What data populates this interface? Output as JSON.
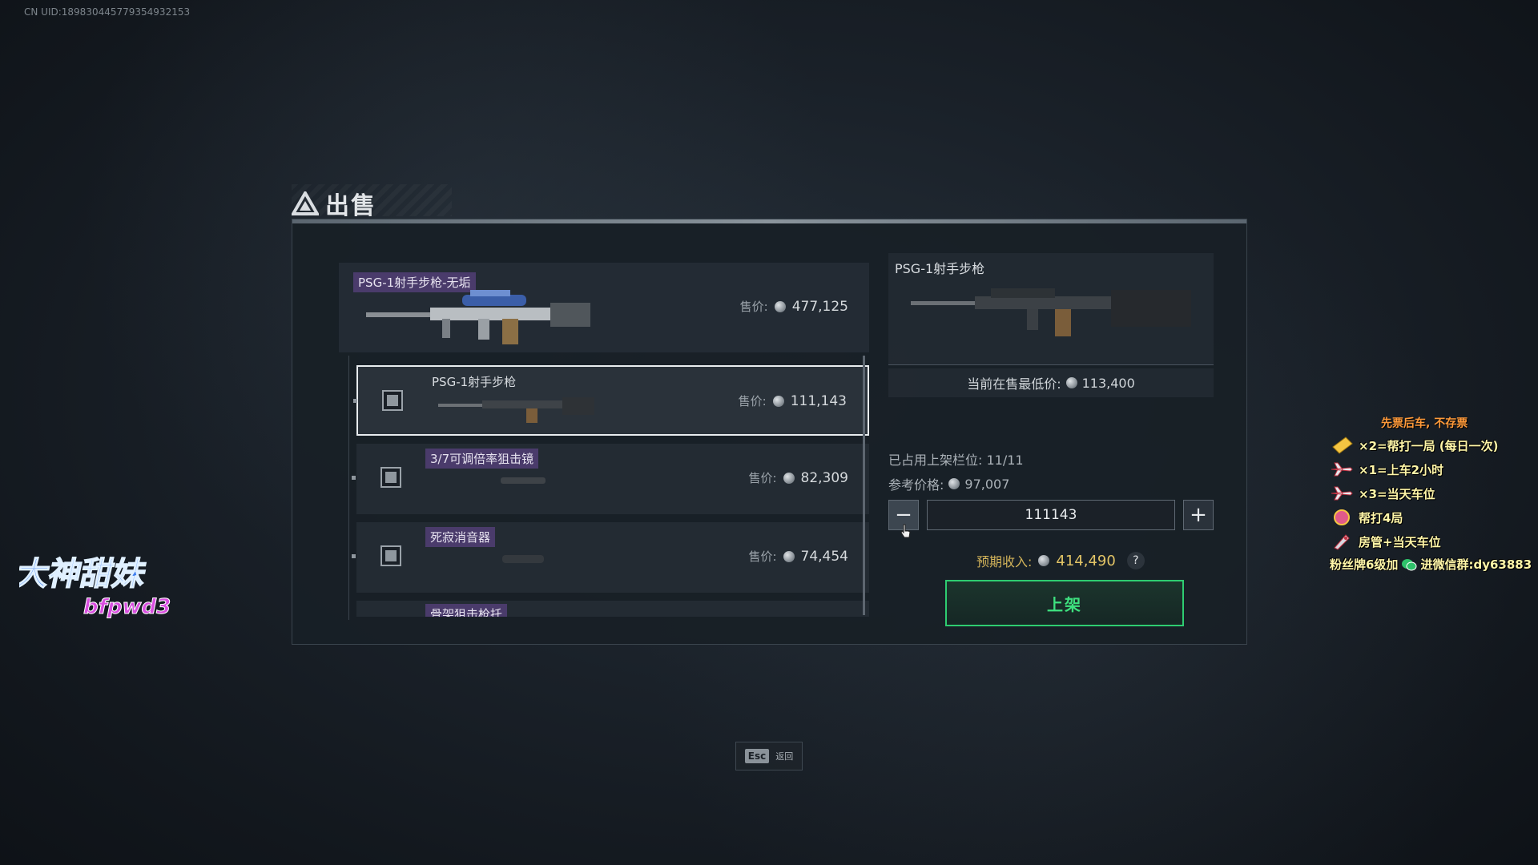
{
  "uid": "CN UID:1898304457793549321​53",
  "dialog": {
    "title": "出售"
  },
  "main_item": {
    "name": "PSG-1射手步枪-无垢",
    "price_label": "售价:",
    "price": "477,125"
  },
  "sub_items": [
    {
      "name": "PSG-1射手步枪",
      "price_label": "售价:",
      "price": "111,143",
      "selected": true
    },
    {
      "name": "3/7可调倍率狙击镜",
      "price_label": "售价:",
      "price": "82,309",
      "selected": false
    },
    {
      "name": "死寂消音器",
      "price_label": "售价:",
      "price": "74,454",
      "selected": false
    },
    {
      "name": "骨架狙击枪托",
      "price_label": "",
      "price": "",
      "selected": false
    }
  ],
  "preview": {
    "name": "PSG-1射手步枪",
    "lowest_label": "当前在售最低价:",
    "lowest_price": "113,400"
  },
  "slots": {
    "label": "已占用上架栏位:",
    "value": "11/11"
  },
  "reference": {
    "label": "参考价格:",
    "value": "97,007"
  },
  "price_input": {
    "value": "111143"
  },
  "stepper": {
    "minus": "−",
    "plus": "+"
  },
  "expected": {
    "label": "预期收入:",
    "value": "414,490",
    "help": "?"
  },
  "list_button": "上架",
  "esc": {
    "key": "Esc",
    "label": "返回"
  },
  "logo": {
    "line1": "大神甜妹",
    "line2": "bfpwd3"
  },
  "overlay": {
    "title": "先票后车, 不存票",
    "rows": [
      {
        "icon": "ticket-icon",
        "text": "×2=帮打一局 (每日一次)"
      },
      {
        "icon": "plane-icon",
        "text": "×1=上车2小时"
      },
      {
        "icon": "plane-icon",
        "text": "×3=当天车位"
      },
      {
        "icon": "badge-icon",
        "text": "帮打4局"
      },
      {
        "icon": "rocket-icon",
        "text": "房管+当天车位"
      }
    ],
    "footer_left": "粉丝牌6级加",
    "footer_right": "进微信群:dy63883"
  },
  "colors": {
    "accent_green": "#2ecc71",
    "tag_purple": "#4a3b6b",
    "gold": "#e2c466",
    "overlay_yellow": "#fff6a8",
    "overlay_orange": "#ff9a3a"
  }
}
